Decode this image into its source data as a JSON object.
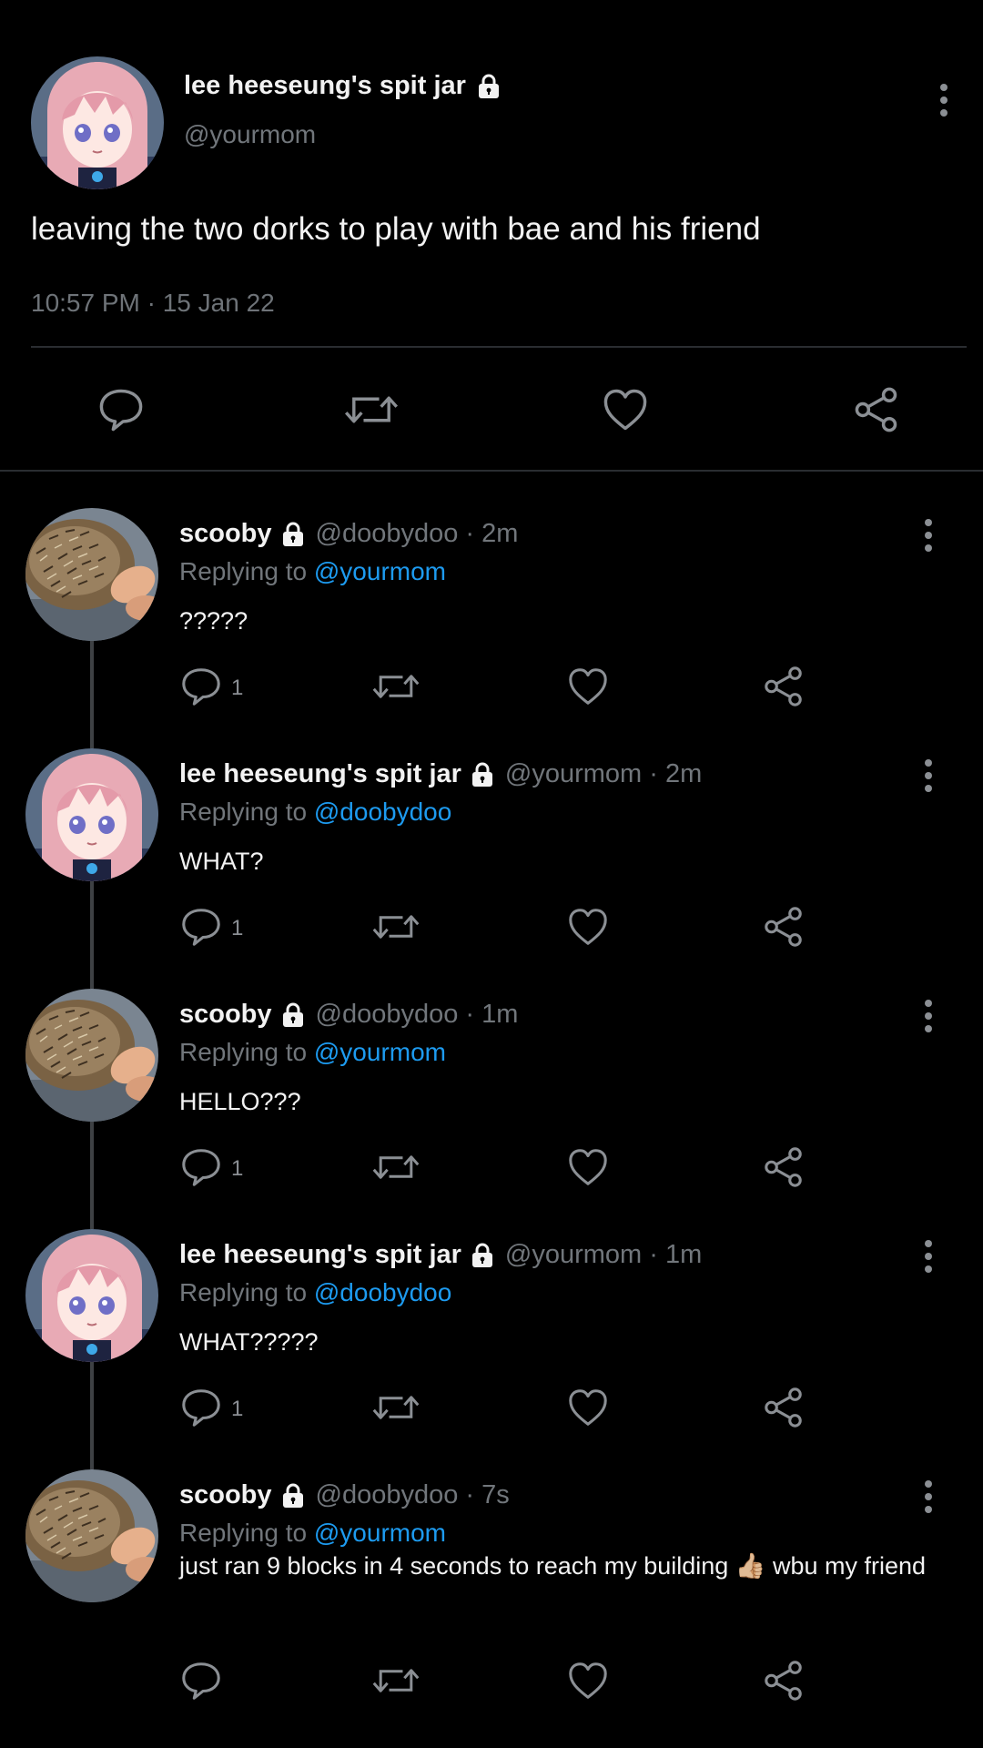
{
  "main_tweet": {
    "author_name": "lee heeseung's spit jar",
    "handle": "@yourmom",
    "text": "leaving the two dorks to play with bae and his friend",
    "timestamp": "10:57 PM · 15 Jan 22",
    "icons": [
      "lock-icon",
      "more-icon",
      "reply-icon",
      "retweet-icon",
      "like-icon",
      "share-icon"
    ]
  },
  "replies": [
    {
      "author_name": "scooby",
      "handle_time": "@doobydoo · 2m",
      "replying_prefix": "Replying to",
      "replying_to": "@yourmom",
      "text": "?????",
      "reply_count": "1"
    },
    {
      "author_name": "lee heeseung's spit jar",
      "handle_time": "@yourmom · 2m",
      "replying_prefix": "Replying to",
      "replying_to": "@doobydoo",
      "text": "WHAT?",
      "reply_count": "1"
    },
    {
      "author_name": "scooby",
      "handle_time": "@doobydoo · 1m",
      "replying_prefix": "Replying to",
      "replying_to": "@yourmom",
      "text": "HELLO???",
      "reply_count": "1"
    },
    {
      "author_name": "lee heeseung's spit jar",
      "handle_time": "@yourmom · 1m",
      "replying_prefix": "Replying to",
      "replying_to": "@doobydoo",
      "text": "WHAT?????",
      "reply_count": "1"
    },
    {
      "author_name": "scooby",
      "handle_time": "@doobydoo · 7s",
      "replying_prefix": "Replying to",
      "replying_to": "@yourmom",
      "text": "just ran 9 blocks in 4 seconds to reach my building 👍🏼 wbu my friend",
      "reply_count": ""
    }
  ],
  "colors": {
    "background": "#000000",
    "mention": "#1d9bf0",
    "secondary_text": "#71767b",
    "divider": "#2a2d31"
  }
}
